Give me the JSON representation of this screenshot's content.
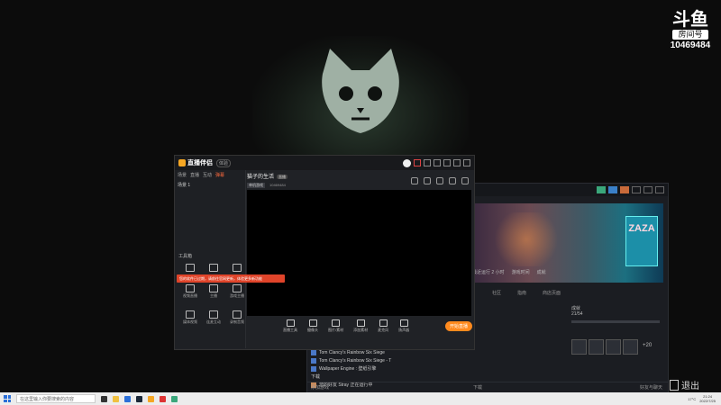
{
  "overlay": {
    "platform_logo": "斗鱼",
    "room_label": "房间号",
    "room_number": "10469484",
    "exit_label": "退出"
  },
  "stream_app": {
    "app_name": "直播伴侣",
    "version_badge": "体验",
    "left_tabs": [
      "场景",
      "直播",
      "互动",
      "弹幕"
    ],
    "scene_label": "场景 1",
    "toolbox_title": "工具箱",
    "tools": [
      "",
      "",
      "",
      "视频直播",
      "主播",
      "游戏主播",
      "媒体视频",
      "连麦互动",
      "录制音频"
    ],
    "stream_title": "猫子的生活",
    "stream_badge": "直播",
    "category_tag": "单机游戏",
    "viewer_label": "10469484",
    "toast_text": "您的软件已过期，请前往官网更新，体验更多新功能",
    "bottom_tools": [
      "直播工具",
      "摄像头",
      "图片/素材",
      "添加素材",
      "麦克风",
      "扬声器"
    ],
    "start_button": "开始直播"
  },
  "launcher": {
    "stats": [
      "最近运行 2 小时",
      "游戏时间",
      "成就"
    ],
    "tabs": [
      "社区",
      "指南",
      "商店页面"
    ],
    "right_panel_title": "成就",
    "right_panel_progress": "21/54",
    "items_more": "+20",
    "library_items": [
      "Tom Clancy's Rainbow Six Siege",
      "Tom Clancy's Rainbow Six Siege - T",
      "Wallpaper Engine : 壁纸引擎",
      "下载"
    ],
    "friend_activity": "您的好友 Stray 正在运行中",
    "footer_left": "添加游戏",
    "footer_mid": "下载",
    "footer_right": "好友与聊天"
  },
  "taskbar": {
    "search_placeholder": "在这里输入你要搜索的内容",
    "tray_temp": "17°C",
    "time": "21:24",
    "date": "2022/7/25"
  },
  "colors": {
    "accent_orange": "#ff8a1e",
    "toast_red": "#e0442a"
  }
}
